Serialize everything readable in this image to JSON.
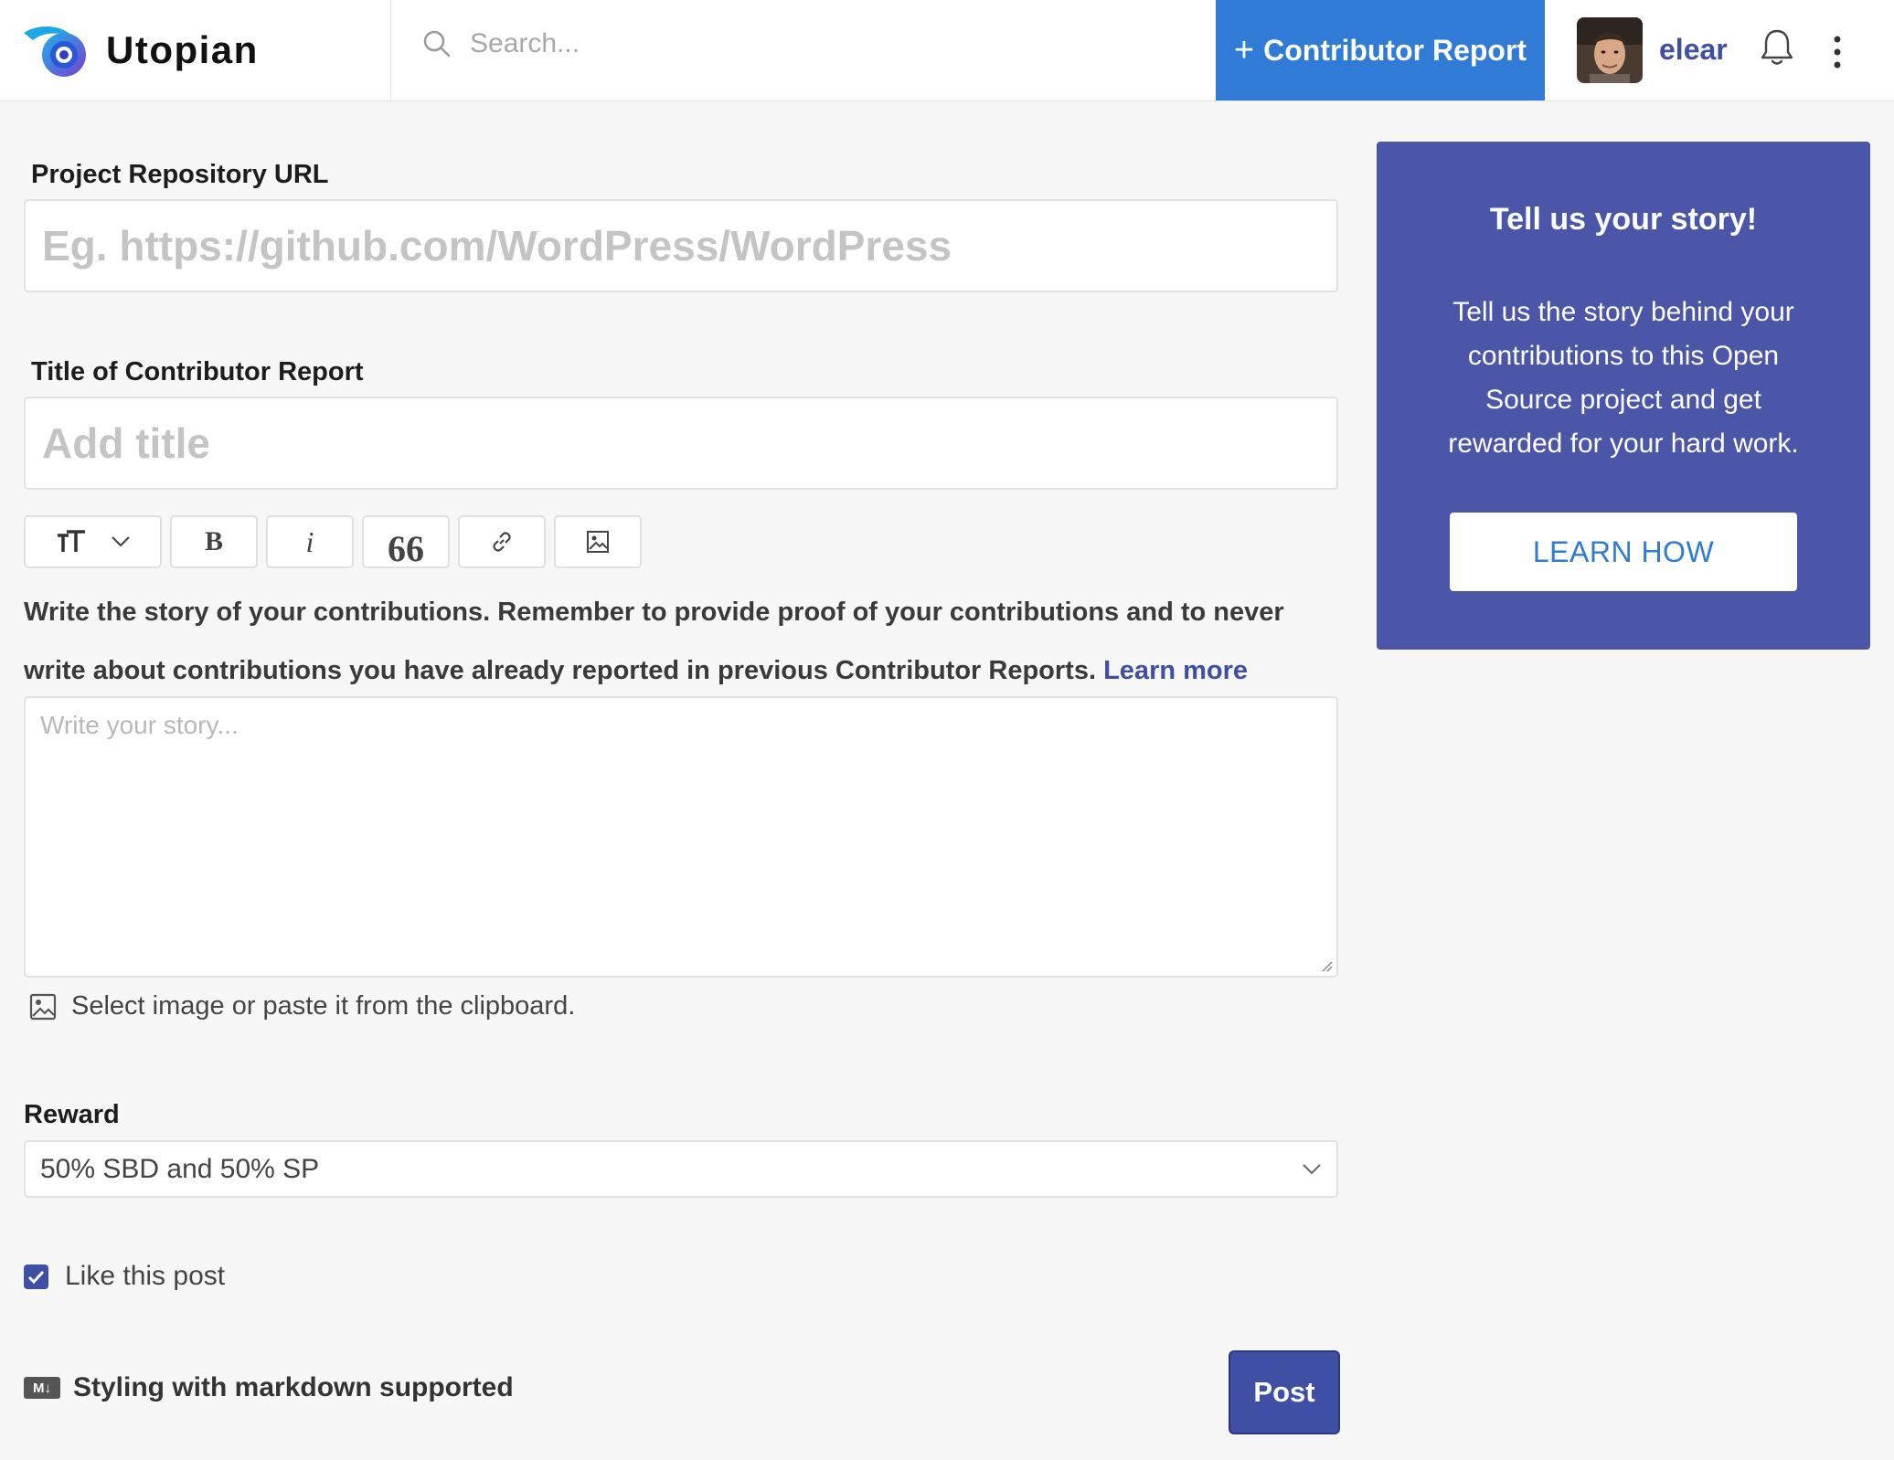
{
  "header": {
    "brand": "Utopian",
    "search_placeholder": "Search...",
    "contributor_button": "Contributor Report",
    "contributor_plus": "+",
    "username": "elear"
  },
  "form": {
    "repo_label": "Project Repository URL",
    "repo_placeholder": "Eg. https://github.com/WordPress/WordPress",
    "title_label": "Title of Contributor Report",
    "title_placeholder": "Add title",
    "toolbar": {
      "bold": "B",
      "italic": "i",
      "quote": "66"
    },
    "instructions": "Write the story of your contributions. Remember to provide proof of your contributions and to never write about contributions you have already reported in previous Contributor Reports.",
    "learn_more": "Learn more",
    "story_placeholder": "Write your story...",
    "select_image": "Select image or paste it from the clipboard.",
    "reward_label": "Reward",
    "reward_value": "50% SBD and 50% SP",
    "like_label": "Like this post",
    "like_checked": true,
    "markdown_note": "Styling with markdown supported",
    "markdown_badge": "M↓",
    "post_button": "Post"
  },
  "promo": {
    "title": "Tell us your story!",
    "body": "Tell us the story behind your contributions to this Open Source project and get rewarded for your hard work.",
    "button": "LEARN HOW"
  },
  "colors": {
    "primary_blue": "#2f7bd6",
    "indigo": "#3f4fa3",
    "promo_bg": "#4b56a8"
  },
  "icons": [
    "utopian-logo-icon",
    "search-icon",
    "bell-icon",
    "more-vertical-icon",
    "text-size-icon",
    "chevron-down-icon",
    "link-icon",
    "image-icon",
    "checkbox-icon",
    "markdown-icon"
  ]
}
